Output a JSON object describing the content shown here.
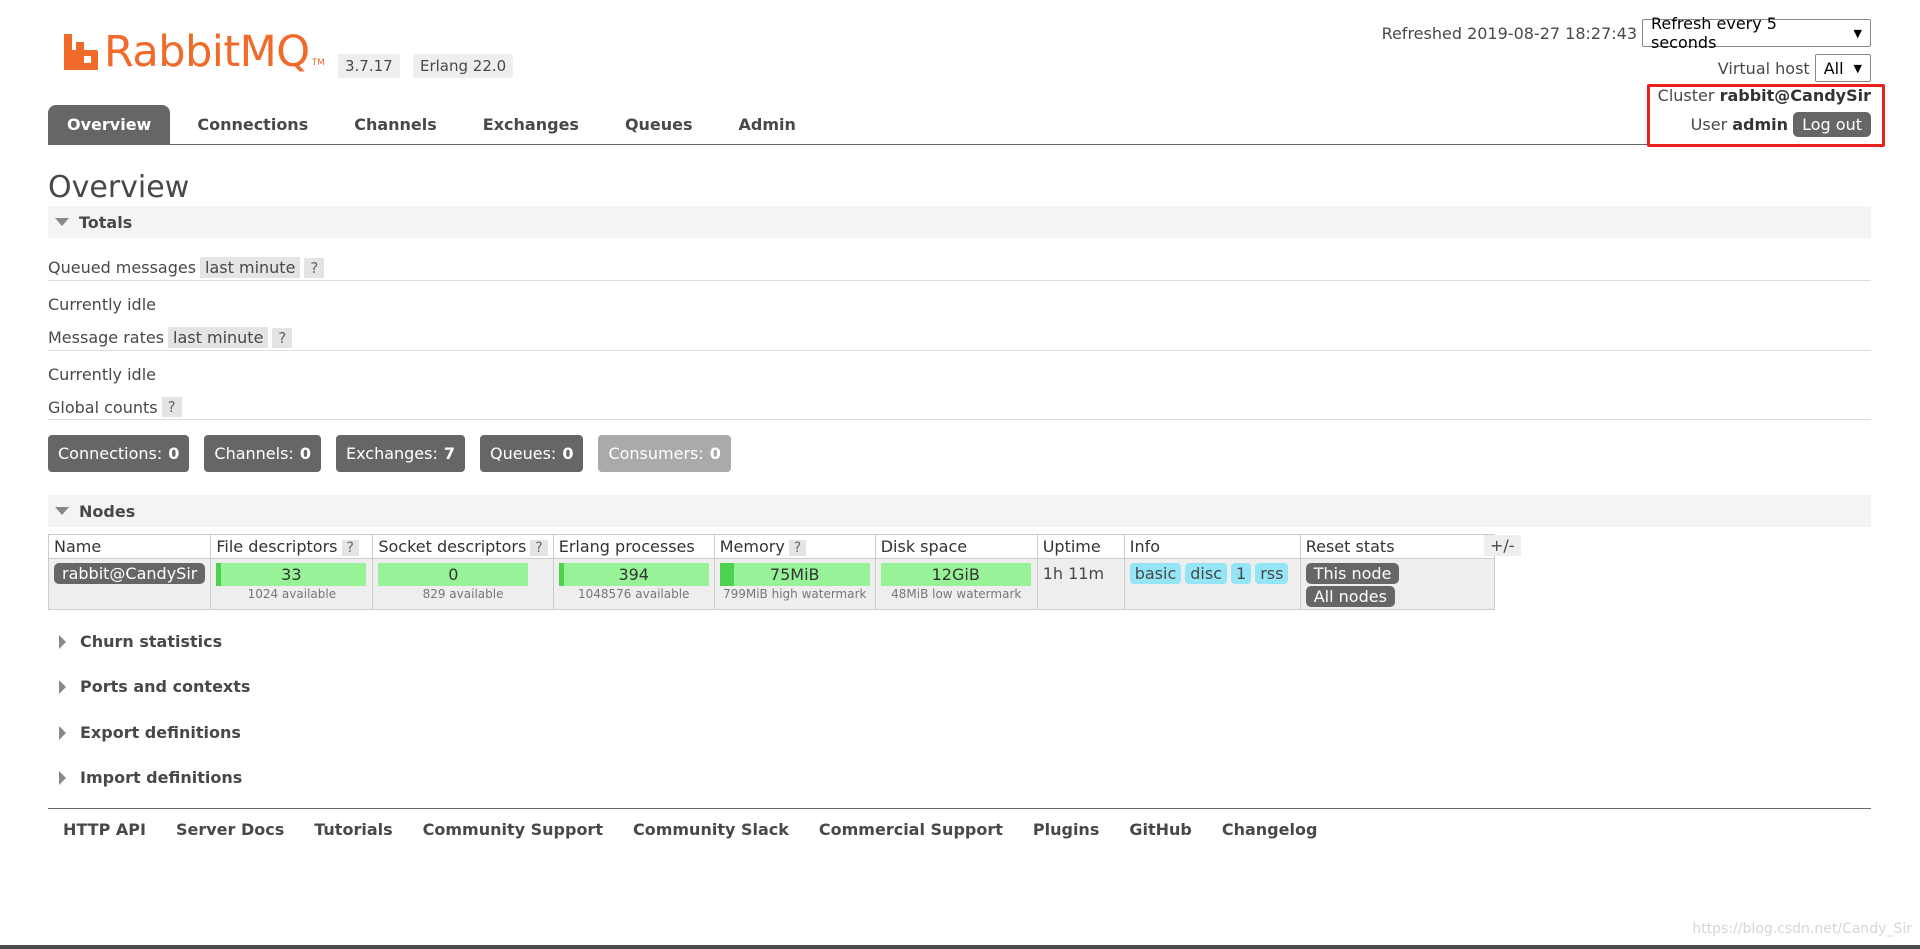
{
  "header": {
    "brand": "RabbitMQ",
    "trademark": "TM",
    "version": "3.7.17",
    "erlang": "Erlang 22.0",
    "refreshed_label": "Refreshed 2019-08-27 18:27:43",
    "refresh_select": "Refresh every 5 seconds",
    "vhost_label": "Virtual host",
    "vhost_select": "All",
    "cluster_label": "Cluster",
    "cluster_name": "rabbit@CandySir",
    "user_label": "User",
    "user_name": "admin",
    "logout": "Log out"
  },
  "tabs": [
    {
      "label": "Overview"
    },
    {
      "label": "Connections"
    },
    {
      "label": "Channels"
    },
    {
      "label": "Exchanges"
    },
    {
      "label": "Queues"
    },
    {
      "label": "Admin"
    }
  ],
  "page_title": "Overview",
  "totals": {
    "heading": "Totals",
    "queued_label": "Queued messages",
    "queued_range": "last minute",
    "help": "?",
    "idle1": "Currently idle",
    "rates_label": "Message rates",
    "rates_range": "last minute",
    "idle2": "Currently idle",
    "global_label": "Global counts",
    "counts": [
      {
        "label": "Connections:",
        "value": "0"
      },
      {
        "label": "Channels:",
        "value": "0"
      },
      {
        "label": "Exchanges:",
        "value": "7"
      },
      {
        "label": "Queues:",
        "value": "0"
      },
      {
        "label": "Consumers:",
        "value": "0"
      }
    ]
  },
  "nodes": {
    "heading": "Nodes",
    "columns": [
      "Name",
      "File descriptors",
      "Socket descriptors",
      "Erlang processes",
      "Memory",
      "Disk space",
      "Uptime",
      "Info",
      "Reset stats"
    ],
    "plus_minus": "+/-",
    "row": {
      "name": "rabbit@CandySir",
      "fd": {
        "value": "33",
        "sub": "1024 available",
        "fraction": 0.032
      },
      "sockets": {
        "value": "0",
        "sub": "829 available",
        "fraction": 0.0
      },
      "procs": {
        "value": "394",
        "sub": "1048576 available",
        "fraction": 0.0004
      },
      "memory": {
        "value": "75MiB",
        "sub": "799MiB high watermark",
        "fraction": 0.094
      },
      "disk": {
        "value": "12GiB",
        "sub": "48MiB low watermark",
        "fraction": 0.0
      },
      "uptime": "1h 11m",
      "info": [
        "basic",
        "disc",
        "1",
        "rss"
      ],
      "reset": [
        "This node",
        "All nodes"
      ]
    }
  },
  "collapsed_sections": [
    {
      "label": "Churn statistics"
    },
    {
      "label": "Ports and contexts"
    },
    {
      "label": "Export definitions"
    },
    {
      "label": "Import definitions"
    }
  ],
  "footer": [
    {
      "label": "HTTP API"
    },
    {
      "label": "Server Docs"
    },
    {
      "label": "Tutorials"
    },
    {
      "label": "Community Support"
    },
    {
      "label": "Community Slack"
    },
    {
      "label": "Commercial Support"
    },
    {
      "label": "Plugins"
    },
    {
      "label": "GitHub"
    },
    {
      "label": "Changelog"
    }
  ],
  "watermark": "https://blog.csdn.net/Candy_Sir",
  "colors": {
    "brand": "#f26a2a",
    "tab_active": "#666666",
    "bar_fill": "#98f398",
    "info_tag": "#94e5f6",
    "highlight": "#e8211c"
  }
}
